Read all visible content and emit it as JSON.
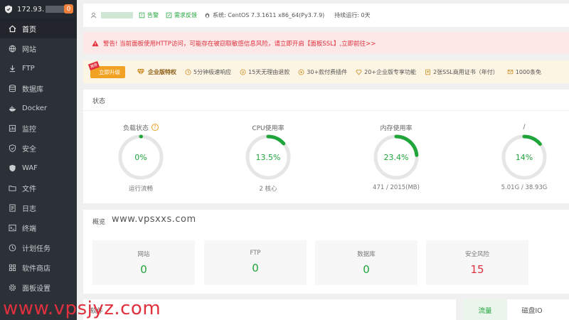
{
  "sidebar": {
    "ip": "172.93.",
    "badge": "0",
    "items": [
      {
        "label": "首页",
        "icon": "home-icon"
      },
      {
        "label": "网站",
        "icon": "globe-icon"
      },
      {
        "label": "FTP",
        "icon": "ftp-icon"
      },
      {
        "label": "数据库",
        "icon": "database-icon"
      },
      {
        "label": "Docker",
        "icon": "docker-icon"
      },
      {
        "label": "监控",
        "icon": "monitor-icon"
      },
      {
        "label": "安全",
        "icon": "shield-icon"
      },
      {
        "label": "WAF",
        "icon": "waf-icon"
      },
      {
        "label": "文件",
        "icon": "folder-icon"
      },
      {
        "label": "日志",
        "icon": "log-icon"
      },
      {
        "label": "终端",
        "icon": "terminal-icon"
      },
      {
        "label": "计划任务",
        "icon": "clock-icon"
      },
      {
        "label": "软件商店",
        "icon": "grid-icon"
      },
      {
        "label": "面板设置",
        "icon": "gear-icon"
      }
    ]
  },
  "topbar": {
    "alert": "告警",
    "feedback": "需求反馈",
    "system": "系统:  CentOS 7.3.1611 x86_64(Py3.7.9)",
    "uptime": "持续运行: 0天"
  },
  "warning": {
    "text": "警告! 当前面板使用HTTP访问，可能存在被窃取敏感信息风险，请立即开启【面板SSL】,立即前往>>"
  },
  "promo": {
    "tag": "推荐",
    "button": "立即升级",
    "title": "企业版特权",
    "features": [
      "5分钟极速响应",
      "15天无理由退款",
      "30+款付费插件",
      "20+企业版专享功能",
      "2张SSL商用证书（年付）",
      "1000条免"
    ]
  },
  "status": {
    "title": "状态",
    "gauges": [
      {
        "label": "负载状态",
        "value": "0%",
        "sub": "运行流畅",
        "percent": 0
      },
      {
        "label": "CPU使用率",
        "value": "13.5%",
        "sub": "2 核心",
        "percent": 13.5
      },
      {
        "label": "内存使用率",
        "value": "23.4%",
        "sub": "471 / 2015(MB)",
        "percent": 23.4
      },
      {
        "label": "/",
        "value": "14%",
        "sub": "5.01G / 38.93G",
        "percent": 14
      }
    ]
  },
  "overview": {
    "title": "概览",
    "domain": "www.vpsxxs.com",
    "cards": [
      {
        "label": "网站",
        "value": "0"
      },
      {
        "label": "FTP",
        "value": "0"
      },
      {
        "label": "数据库",
        "value": "0"
      },
      {
        "label": "安全风险",
        "value": "15"
      }
    ]
  },
  "bottom": {
    "left_title": "软件",
    "tab1": "流量",
    "tab2": "磁盘IO"
  },
  "watermark": "www.vpsjyz.com",
  "colors": {
    "accent": "#20a53a",
    "danger": "#e0303d",
    "sidebar": "#2c3138",
    "warn_orange": "#f2a223"
  }
}
